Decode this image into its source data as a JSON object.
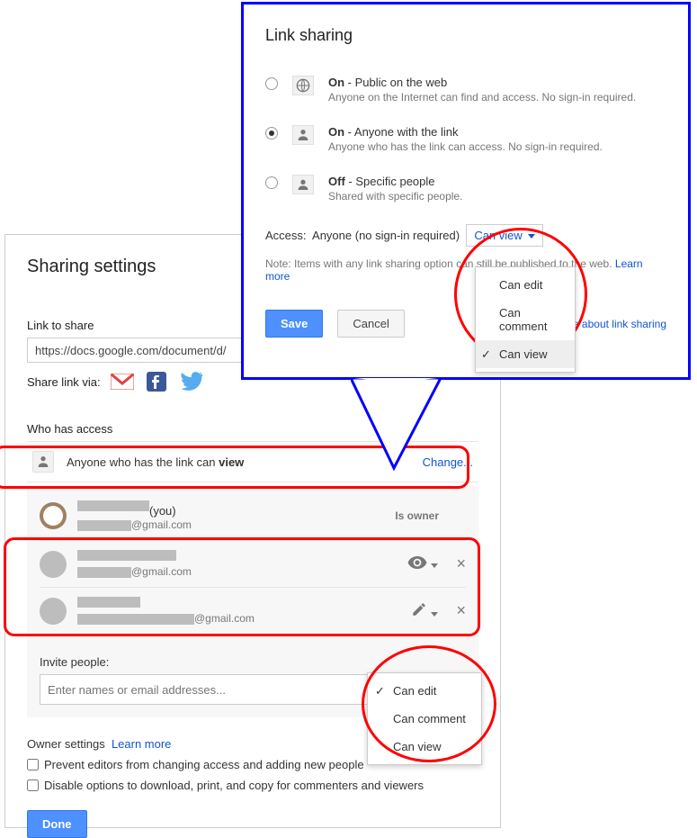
{
  "sharing": {
    "title": "Sharing settings",
    "link_to_share_label": "Link to share",
    "url": "https://docs.google.com/document/d/",
    "share_via_label": "Share link via:",
    "who_has_access_label": "Who has access",
    "access_summary_prefix": "Anyone who has the link can ",
    "access_summary_perm": "view",
    "change_link": "Change...",
    "people": [
      {
        "name_suffix": "(you)",
        "email_suffix": "@gmail.com",
        "role": "Is owner"
      },
      {
        "email_suffix": "@gmail.com",
        "perm": "view"
      },
      {
        "email_suffix": "@gmail.com",
        "perm": "edit"
      }
    ],
    "invite_label": "Invite people:",
    "invite_placeholder": "Enter names or email addresses...",
    "invite_menu": [
      "Can edit",
      "Can comment",
      "Can view"
    ],
    "invite_selected": "Can edit",
    "owner_settings_label": "Owner settings",
    "learn_more": "Learn more",
    "checkbox1": "Prevent editors from changing access and adding new people",
    "checkbox2": "Disable options to download, print, and copy for commenters and viewers",
    "done": "Done"
  },
  "link_sharing": {
    "title": "Link sharing",
    "options": [
      {
        "label_bold": "On",
        "label_rest": " - Public on the web",
        "sub": "Anyone on the Internet can find and access. No sign-in required.",
        "checked": false,
        "icon": "globe"
      },
      {
        "label_bold": "On",
        "label_rest": " - Anyone with the link",
        "sub": "Anyone who has the link can access. No sign-in required.",
        "checked": true,
        "icon": "link-person"
      },
      {
        "label_bold": "Off",
        "label_rest": " - Specific people",
        "sub": "Shared with specific people.",
        "checked": false,
        "icon": "person"
      }
    ],
    "access_label": "Access:",
    "access_who": "Anyone (no sign-in required)",
    "access_perm": "Can view",
    "perm_menu": [
      "Can edit",
      "Can comment",
      "Can view"
    ],
    "perm_selected": "Can view",
    "note_prefix": "Note: Items with any link sharing option can still be published to the web. ",
    "note_learn_more": "Learn more",
    "save": "Save",
    "cancel": "Cancel",
    "learn_more_link_sharing": "Learn more about link sharing"
  }
}
